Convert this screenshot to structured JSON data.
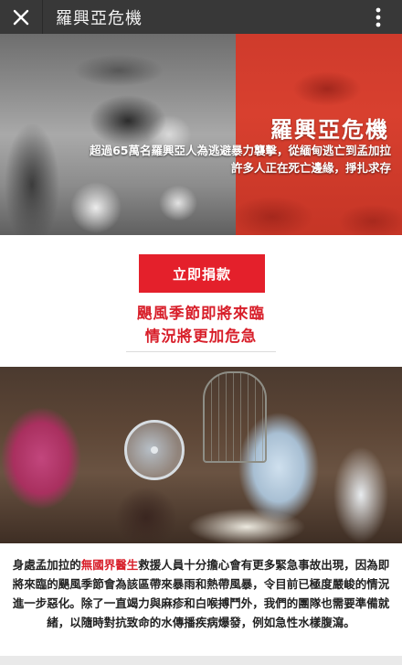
{
  "appbar": {
    "title": "羅興亞危機",
    "close_icon": "close-icon",
    "more_icon": "more-vertical-icon"
  },
  "hero": {
    "title": "羅興亞危機",
    "subtitle_line1": "超過65萬名羅興亞人為逃避暴力襲擊，從緬甸逃亡到孟加拉",
    "subtitle_line2": "許多人正在死亡邊緣，掙扎求存"
  },
  "donate": {
    "button_label": "立即捐款"
  },
  "headline": {
    "line1": "颶風季節即將來臨",
    "line2": "情況將更加危急"
  },
  "body": {
    "part1": "身處孟加拉的",
    "org_name": "無國界醫生",
    "part2": "救援人員十分擔心會有更多緊急事故出現，因為即將來臨的颶風季節會為該區帶來暴雨和熱帶風暴，令目前已極度嚴峻的情況進一步惡化。除了一直竭力與麻疹和白喉搏鬥外，我們的團隊也需要準備就緒，以隨時對抗致命的水傳播疾病爆發，例如急性水樣腹瀉。"
  },
  "colors": {
    "appbar_bg": "#383838",
    "accent_red": "#e4202b",
    "headline_red": "#d81f2a",
    "hero_red_panel": "#d8402f"
  }
}
